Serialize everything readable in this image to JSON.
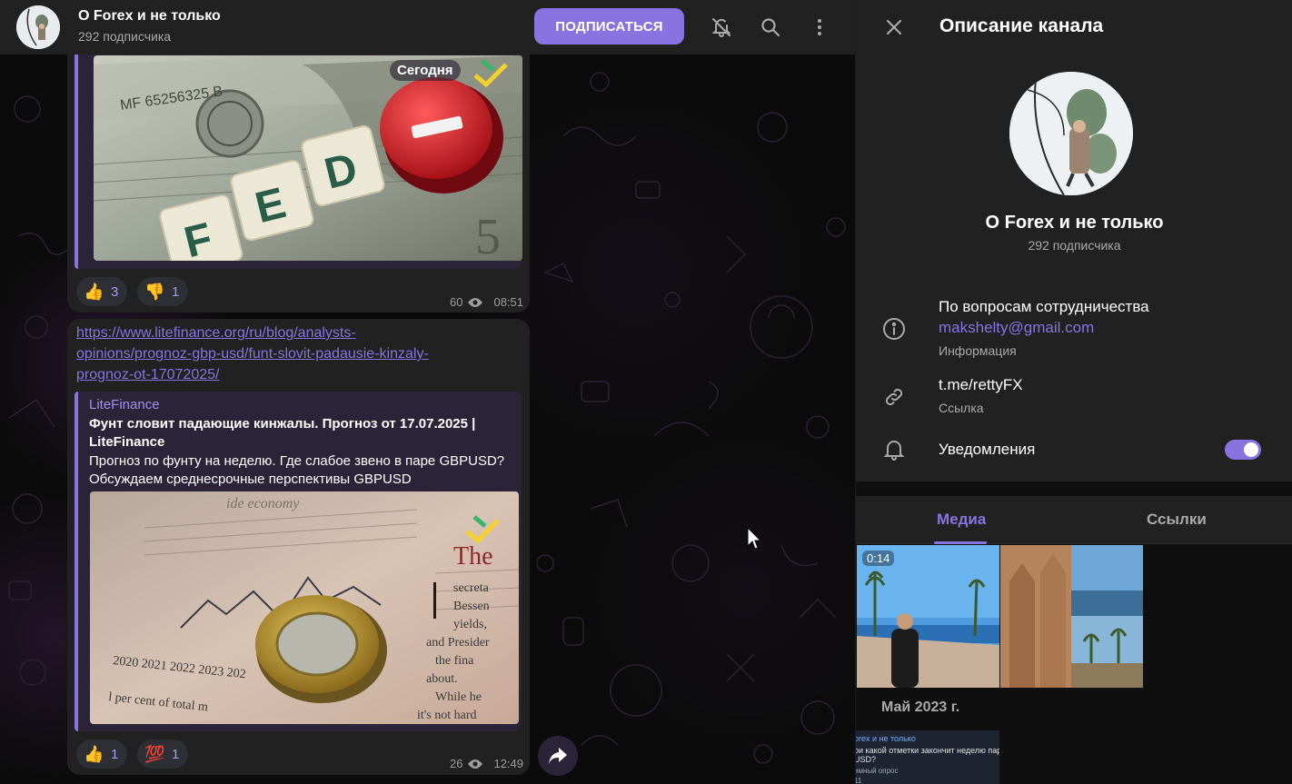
{
  "header": {
    "title": "O Forex и не только",
    "subscribers": "292 подписчика",
    "subscribe_label": "ПОДПИСАТЬСЯ",
    "icons": [
      "bell-off-icon",
      "search-icon",
      "more-vertical-icon"
    ]
  },
  "colors": {
    "accent": "#8774e1",
    "bubble": "#212121",
    "panel": "#212121",
    "background": "#0f0f0f"
  },
  "messages": [
    {
      "date_pill": "Сегодня",
      "image_text": "FED",
      "reactions": [
        {
          "emoji": "👍",
          "count": "3"
        },
        {
          "emoji": "👎",
          "count": "1"
        }
      ],
      "views": "60",
      "time": "08:51"
    },
    {
      "link_lines": [
        "https://www.litefinance.org/ru/blog/analysts-",
        "opinions/prognoz-gbp-usd/funt-slovit-padausie-kinzaly-",
        "prognoz-ot-17072025/"
      ],
      "preview": {
        "site": "LiteFinance",
        "title_line1": "Фунт словит падающие кинжалы. Прогноз от 17.07.2025 |",
        "title_line2": "LiteFinance",
        "desc_line1": "Прогноз по фунту на неделю. Где слабое звено в паре GBPUSD?",
        "desc_line2": "Обсуждаем среднесрочные перспективы GBPUSD"
      },
      "reactions": [
        {
          "emoji": "👍",
          "count": "1"
        },
        {
          "emoji": "💯",
          "count": "1"
        }
      ],
      "views": "26",
      "time": "12:49"
    }
  ],
  "panel": {
    "title": "Описание канала",
    "name": "O Forex и не только",
    "subscribers": "292 подписчика",
    "info_text": "По вопросам сотрудничества",
    "info_email": "makshelty@gmail.com",
    "info_caption": "Информация",
    "link_text": "t.me/rettyFX",
    "link_caption": "Ссылка",
    "notifications_label": "Уведомления",
    "notifications_on": true,
    "tabs": [
      "Медиа",
      "Ссылки"
    ],
    "active_tab": "Медиа",
    "video_duration": "0:14",
    "month_label": "Май 2023 г.",
    "poll_preview": {
      "line1": "orex и не только",
      "line2": "ои какой отметки закончит неделю пара",
      "line3": "USD?",
      "line4": "имный опрос",
      "line5": "11"
    }
  }
}
